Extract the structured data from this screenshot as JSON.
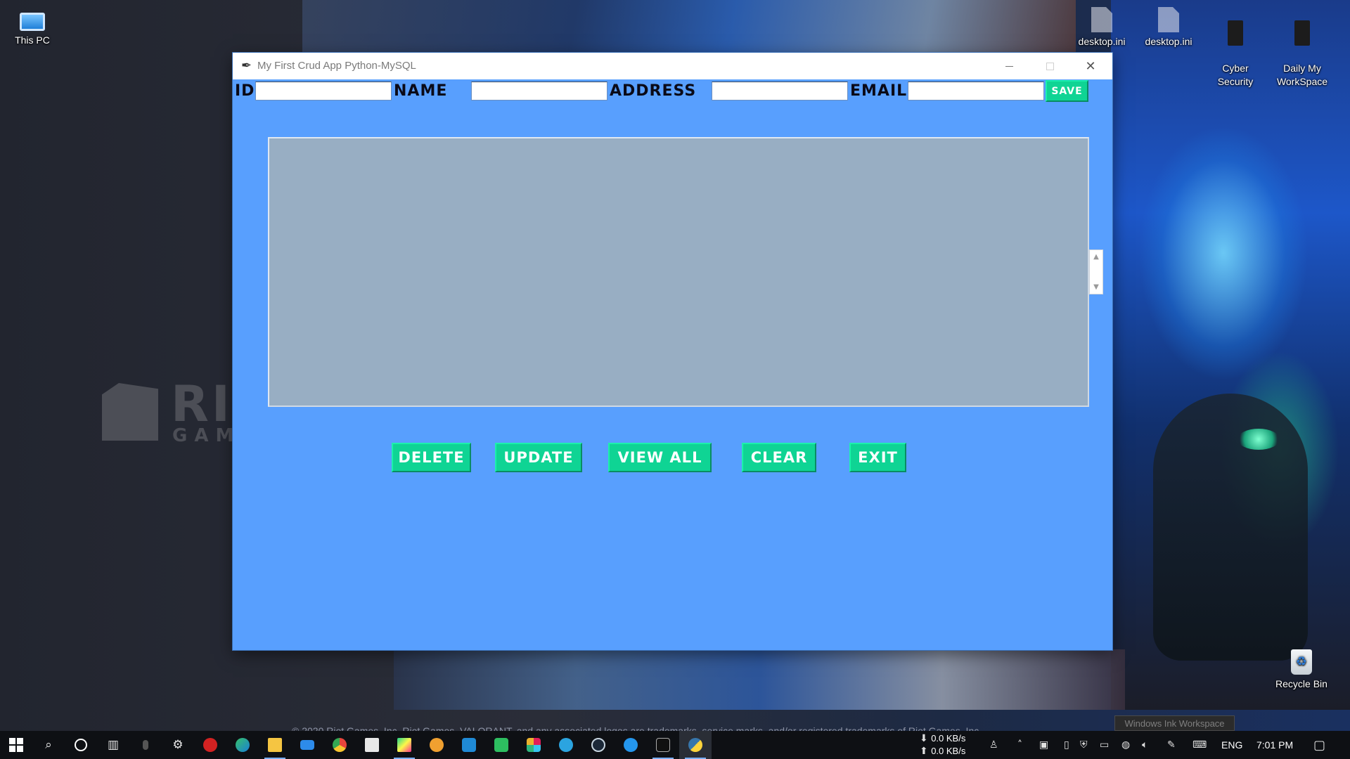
{
  "desktop": {
    "icons": {
      "this_pc": "This PC",
      "desktop_ini_1": "desktop.ini",
      "desktop_ini_2": "desktop.ini",
      "cyber_security": "Cyber\nSecurity",
      "daily_workspace": "Daily My\nWorkSpace",
      "recycle_bin": "Recycle Bin"
    },
    "wallpaper": {
      "brand_text": "RI",
      "brand_sub": "GAM",
      "copyright": "© 2020 Riot Games, Inc. Riot Games, VALORANT, and any associated logos are trademarks, service marks, and/or registered trademarks of Riot Games, Inc."
    },
    "ink_tooltip": "Windows Ink Workspace"
  },
  "window": {
    "title": "My First Crud App Python-MySQL",
    "controls": {
      "minimize": "–",
      "maximize": "□",
      "close": "✕"
    },
    "form": {
      "id_label": "ID",
      "name_label": "NAME",
      "address_label": "ADDRESS",
      "email_label": "EMAIL",
      "id_value": "",
      "name_value": "",
      "address_value": "",
      "email_value": "",
      "save_button": "SAVE"
    },
    "list": {
      "rows": []
    },
    "scroll": {
      "up": "▲",
      "down": "▼"
    },
    "buttons": {
      "delete": "DELETE",
      "update": "UPDATE",
      "view_all": "VIEW ALL",
      "clear": "CLEAR",
      "exit": "EXIT"
    },
    "colors": {
      "window_bg": "#589ffe",
      "button_bg": "#0fd494",
      "listbox_bg": "#98aec3"
    }
  },
  "taskbar": {
    "pinned": [
      "windows-start",
      "search",
      "cortana",
      "task-view",
      "mouse",
      "settings",
      "antivirus",
      "edge",
      "file-explorer",
      "mail",
      "chrome",
      "store",
      "pycharm",
      "blender",
      "vscode",
      "evernote",
      "slack",
      "telegram",
      "steam",
      "docker",
      "terminal",
      "python-tk"
    ],
    "net_down": "0.0 KB/s",
    "net_up": "0.0 KB/s",
    "language": "ENG",
    "time": "7:01 PM"
  }
}
